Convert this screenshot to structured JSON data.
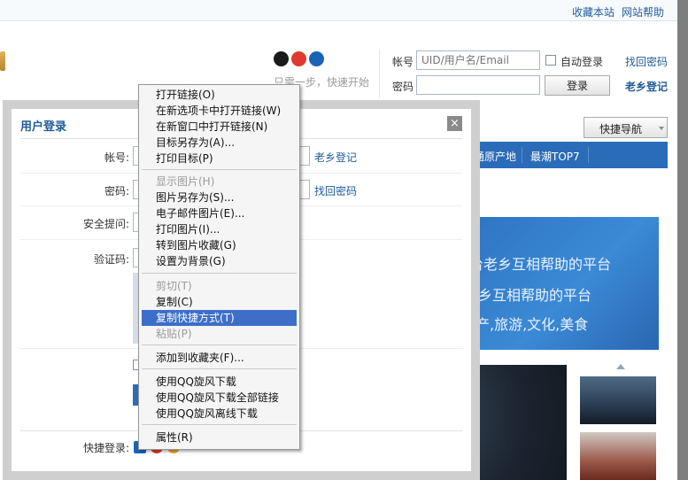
{
  "top_links": [
    "收藏本站",
    "网站帮助"
  ],
  "header": {
    "tagline": "只需一步，快速开始",
    "account_label": "帐号",
    "account_placeholder": "UID/用户名/Email",
    "auto_login": "自动登录",
    "retrieve_password": "找回密码",
    "password_label": "密码",
    "login_button": "登录",
    "laoxiang_login": "老乡登记"
  },
  "quick_nav": "快捷导航",
  "nav": [
    "通原产地",
    "最潮TOP7"
  ],
  "banner": [
    "台老乡互相帮助的平台",
    "乡互相帮助的平台",
    "产,旅游,文化,美食"
  ],
  "dialog": {
    "title": "用户登录",
    "close": "×",
    "account_label": "帐号:",
    "password_label": "密码:",
    "security_label": "安全提问:",
    "captcha_label": "验证码:",
    "laoxiang_login": "老乡登记",
    "retrieve_password": "找回密码",
    "quick_login_label": "快捷登录:"
  },
  "context_menu": {
    "items": [
      {
        "label": "打开链接(O)",
        "disabled": false
      },
      {
        "label": "在新选项卡中打开链接(W)",
        "disabled": false
      },
      {
        "label": "在新窗口中打开链接(N)",
        "disabled": false
      },
      {
        "label": "目标另存为(A)...",
        "disabled": false
      },
      {
        "label": "打印目标(P)",
        "disabled": false
      },
      {
        "label": "显示图片(H)",
        "disabled": true
      },
      {
        "label": "图片另存为(S)...",
        "disabled": false
      },
      {
        "label": "电子邮件图片(E)...",
        "disabled": false
      },
      {
        "label": "打印图片(I)...",
        "disabled": false
      },
      {
        "label": "转到图片收藏(G)",
        "disabled": false
      },
      {
        "label": "设置为背景(G)",
        "disabled": false
      },
      {
        "label": "剪切(T)",
        "disabled": true
      },
      {
        "label": "复制(C)",
        "disabled": false
      },
      {
        "label": "复制快捷方式(T)",
        "disabled": false,
        "highlighted": true
      },
      {
        "label": "粘贴(P)",
        "disabled": true
      },
      {
        "label": "添加到收藏夹(F)...",
        "disabled": false
      },
      {
        "label": "使用QQ旋风下载",
        "disabled": false
      },
      {
        "label": "使用QQ旋风下载全部链接",
        "disabled": false
      },
      {
        "label": "使用QQ旋风离线下载",
        "disabled": false
      },
      {
        "label": "属性(R)",
        "disabled": false
      }
    ]
  },
  "colors": {
    "accent": "#2b6cb8",
    "link": "#1f5b9a",
    "highlight": "#3d6fc9"
  }
}
